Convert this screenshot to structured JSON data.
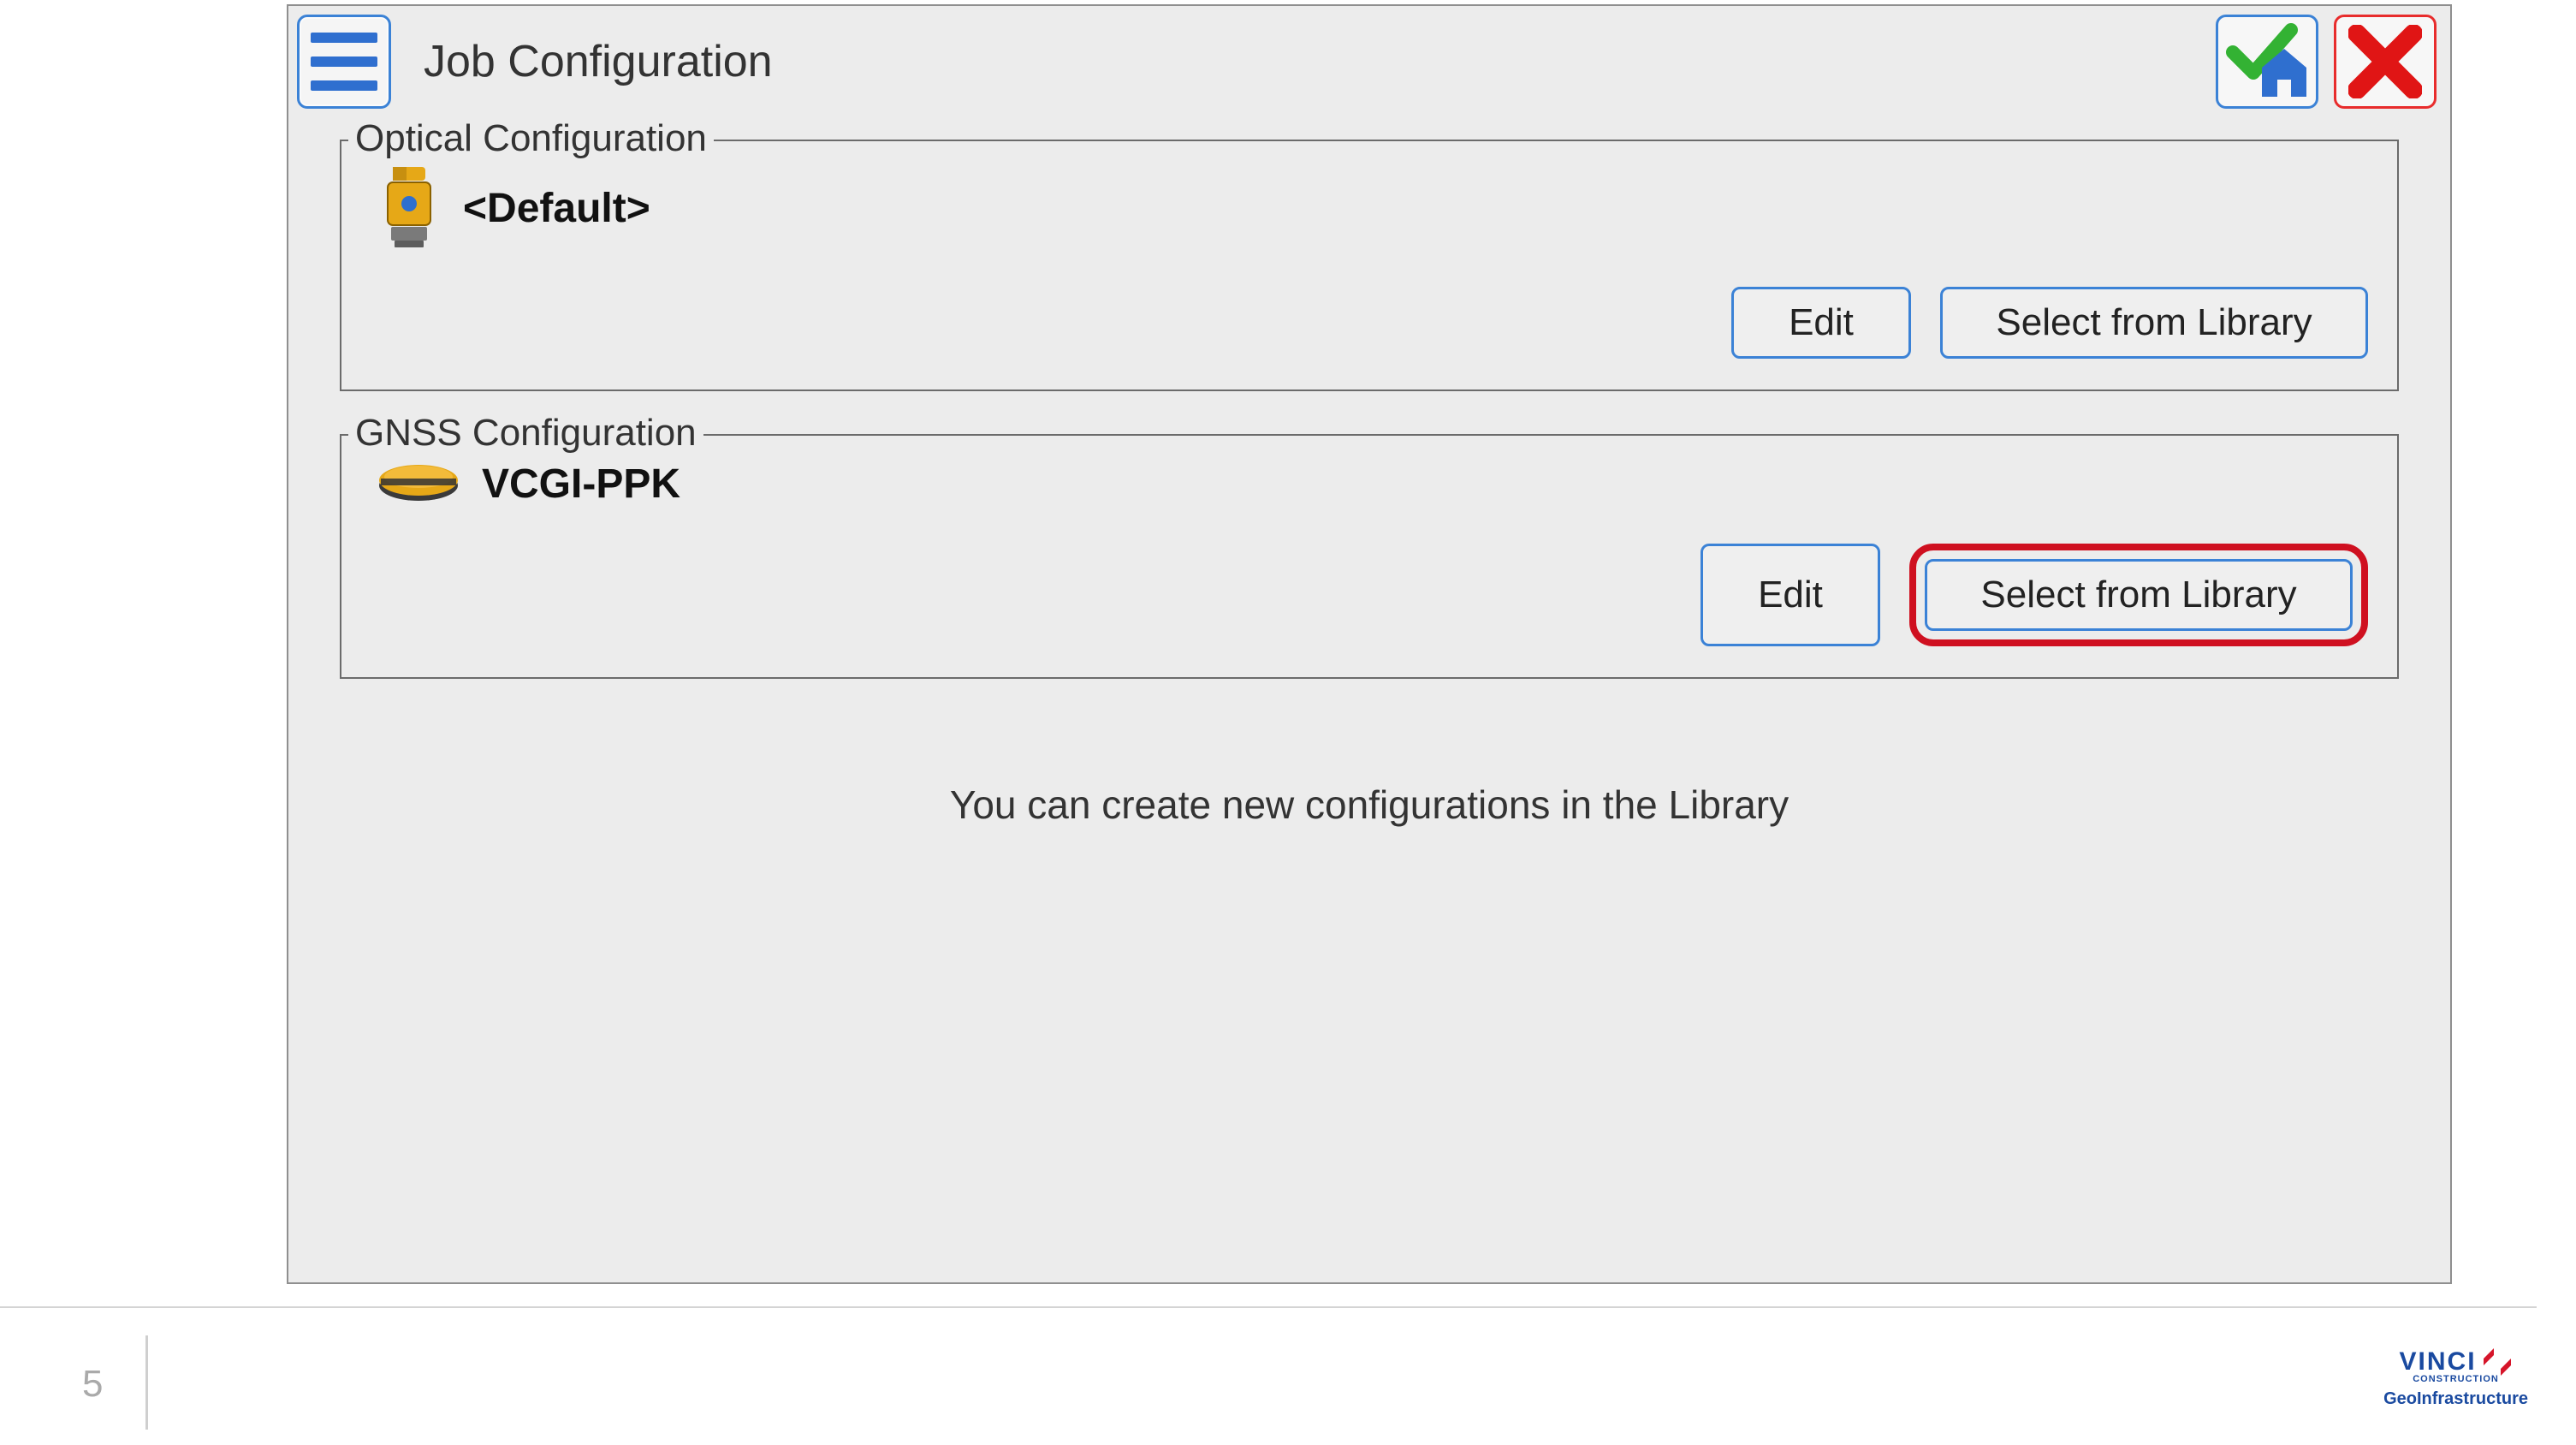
{
  "header": {
    "title": "Job Configuration"
  },
  "optical": {
    "legend": "Optical Configuration",
    "value": "<Default>",
    "edit_label": "Edit",
    "library_label": "Select from Library"
  },
  "gnss": {
    "legend": "GNSS Configuration",
    "value": "VCGI-PPK",
    "edit_label": "Edit",
    "library_label": "Select from Library"
  },
  "hint": "You can create new configurations in the Library",
  "footer": {
    "page_number": "5",
    "brand_name": "VINCI",
    "brand_sub1": "CONSTRUCTION",
    "brand_sub2": "GeoInfrastructure"
  }
}
